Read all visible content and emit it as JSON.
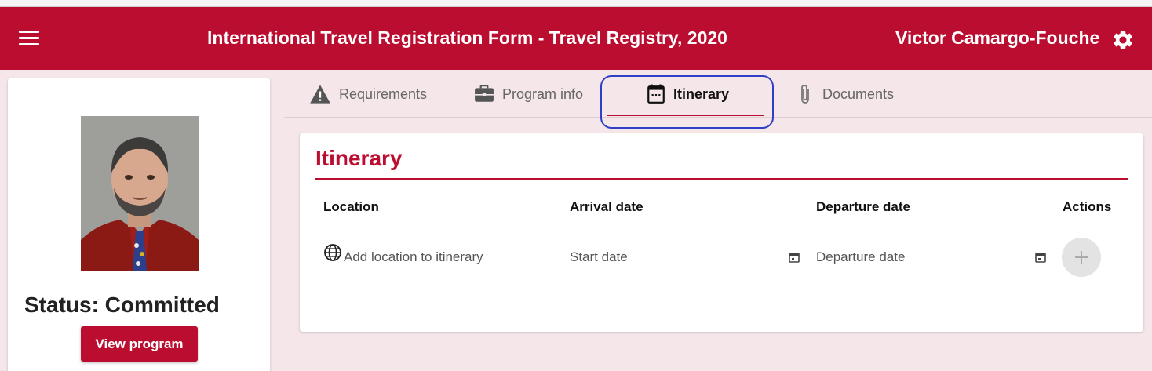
{
  "header": {
    "title": "International Travel Registration Form - Travel Registry, 2020",
    "user_name": "Victor Camargo-Fouche"
  },
  "profile": {
    "status": "Status: Committed",
    "view_program_label": "View program"
  },
  "tabs": [
    {
      "label": "Requirements",
      "icon": "warning-icon"
    },
    {
      "label": "Program info",
      "icon": "briefcase-icon"
    },
    {
      "label": "Itinerary",
      "icon": "calendar-icon",
      "active": true
    },
    {
      "label": "Documents",
      "icon": "paperclip-icon"
    }
  ],
  "itinerary": {
    "title": "Itinerary",
    "columns": [
      "Location",
      "Arrival date",
      "Departure date",
      "Actions"
    ],
    "location_placeholder": "Add location to itinerary",
    "arrival_placeholder": "Start date",
    "departure_placeholder": "Departure date"
  },
  "colors": {
    "brand": "#bb0d2f",
    "highlight": "#2f3fc7"
  }
}
